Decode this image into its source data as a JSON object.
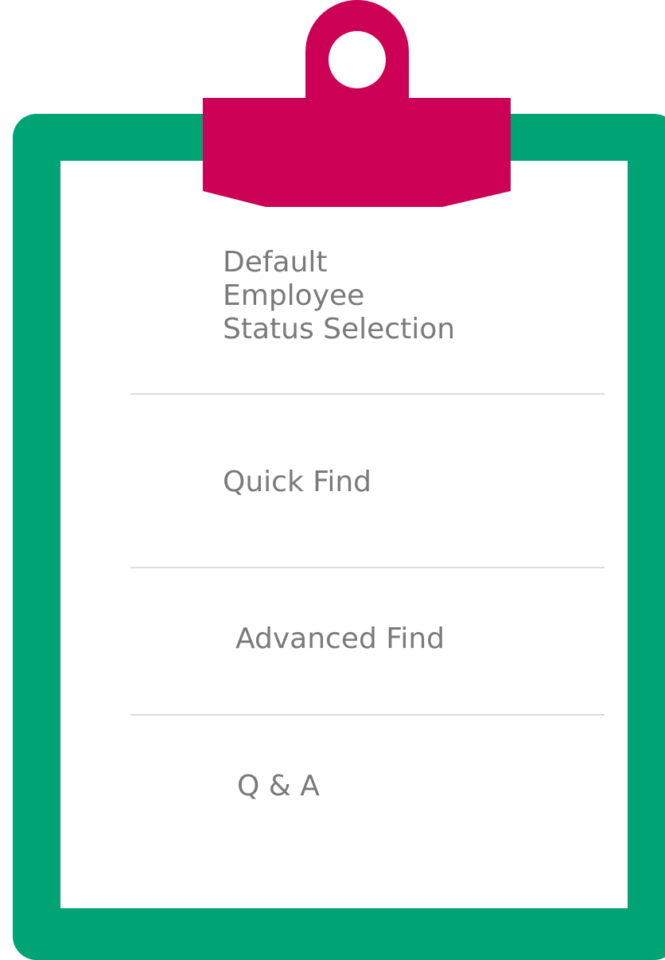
{
  "colors": {
    "board": "#00a374",
    "clip": "#cc0055",
    "paper": "#ffffff",
    "text": "#7a7a7a",
    "divider": "#dcdcdc"
  },
  "menu": {
    "items": [
      {
        "label": "Default\nEmployee\nStatus Selection"
      },
      {
        "label": "Quick Find"
      },
      {
        "label": "Advanced Find"
      },
      {
        "label": "Q & A"
      }
    ]
  }
}
